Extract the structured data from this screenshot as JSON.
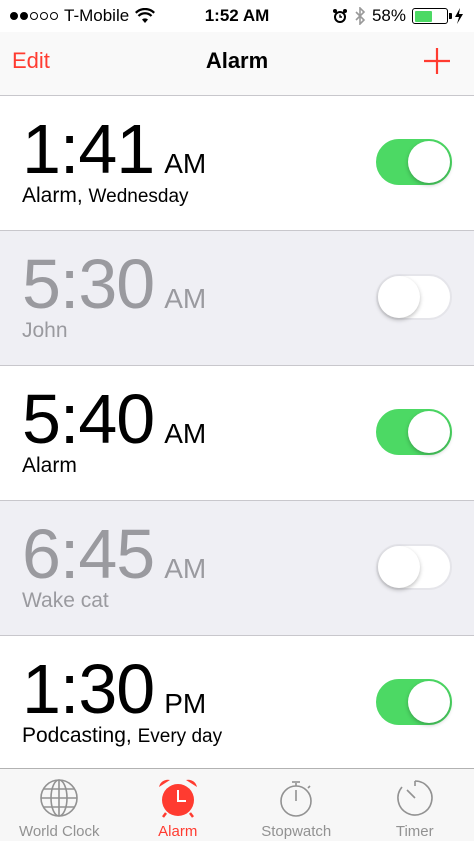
{
  "status_bar": {
    "carrier": "T-Mobile",
    "time": "1:52 AM",
    "battery_percent": "58%",
    "battery_level": 0.58,
    "signal_bars": 2,
    "signal_total": 5
  },
  "nav": {
    "edit_label": "Edit",
    "title": "Alarm"
  },
  "alarms": [
    {
      "time": "1:41",
      "ampm": "AM",
      "label": "Alarm,",
      "repeat": "Wednesday",
      "enabled": true
    },
    {
      "time": "5:30",
      "ampm": "AM",
      "label": "John",
      "repeat": "",
      "enabled": false
    },
    {
      "time": "5:40",
      "ampm": "AM",
      "label": "Alarm",
      "repeat": "",
      "enabled": true
    },
    {
      "time": "6:45",
      "ampm": "AM",
      "label": "Wake cat",
      "repeat": "",
      "enabled": false
    },
    {
      "time": "1:30",
      "ampm": "PM",
      "label": "Podcasting,",
      "repeat": "Every day",
      "enabled": true
    }
  ],
  "tabs": [
    {
      "label": "World Clock",
      "icon": "globe-icon",
      "active": false
    },
    {
      "label": "Alarm",
      "icon": "alarm-clock-icon",
      "active": true
    },
    {
      "label": "Stopwatch",
      "icon": "stopwatch-icon",
      "active": false
    },
    {
      "label": "Timer",
      "icon": "timer-icon",
      "active": false
    }
  ],
  "colors": {
    "accent": "#ff3b30",
    "toggle_on": "#4cd964",
    "inactive_row": "#efeff4",
    "inactive_text": "#9a9a9f"
  }
}
